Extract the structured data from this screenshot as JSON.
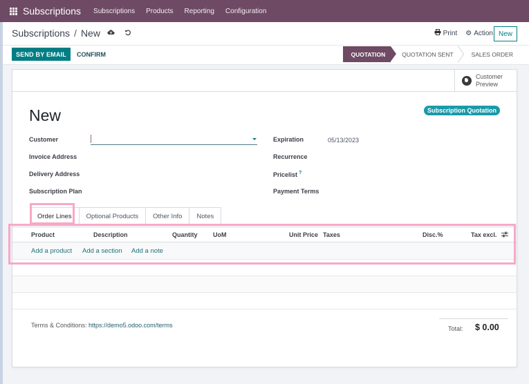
{
  "navbar": {
    "brand": "Subscriptions",
    "menu": [
      "Subscriptions",
      "Products",
      "Reporting",
      "Configuration"
    ]
  },
  "control_panel": {
    "breadcrumb_parent": "Subscriptions",
    "breadcrumb_separator": "/",
    "breadcrumb_current": "New",
    "print_label": "Print",
    "action_label": "Action",
    "new_label": "New",
    "send_email_label": "SEND BY EMAIL",
    "confirm_label": "CONFIRM",
    "stages": [
      "QUOTATION",
      "QUOTATION SENT",
      "SALES ORDER"
    ],
    "active_stage": "QUOTATION"
  },
  "sheet": {
    "customer_preview_line1": "Customer",
    "customer_preview_line2": "Preview",
    "badge": "Subscription Quotation",
    "title": "New",
    "left_fields": {
      "customer": {
        "label": "Customer",
        "value": ""
      },
      "invoice_address": {
        "label": "Invoice Address",
        "value": ""
      },
      "delivery_address": {
        "label": "Delivery Address",
        "value": ""
      },
      "subscription_plan": {
        "label": "Subscription Plan",
        "value": ""
      }
    },
    "right_fields": {
      "expiration": {
        "label": "Expiration",
        "value": "05/13/2023"
      },
      "recurrence": {
        "label": "Recurrence",
        "value": ""
      },
      "pricelist": {
        "label": "Pricelist",
        "help": "?",
        "value": ""
      },
      "payment_terms": {
        "label": "Payment Terms",
        "value": ""
      }
    },
    "tabs": [
      "Order Lines",
      "Optional Products",
      "Other Info",
      "Notes"
    ],
    "active_tab": "Order Lines",
    "table": {
      "columns": [
        "Product",
        "Description",
        "Quantity",
        "UoM",
        "Unit Price",
        "Taxes",
        "Disc.%",
        "Tax excl."
      ],
      "add_links": [
        "Add a product",
        "Add a section",
        "Add a note"
      ]
    },
    "terms_label": "Terms & Conditions:",
    "terms_url": "https://demo5.odoo.com/terms",
    "total_label": "Total:",
    "total_value": "$ 0.00"
  },
  "colors": {
    "brand": "#6e4a64",
    "primary": "#017e84",
    "badge": "#1a9aa8",
    "highlight": "#f7a8c7"
  }
}
